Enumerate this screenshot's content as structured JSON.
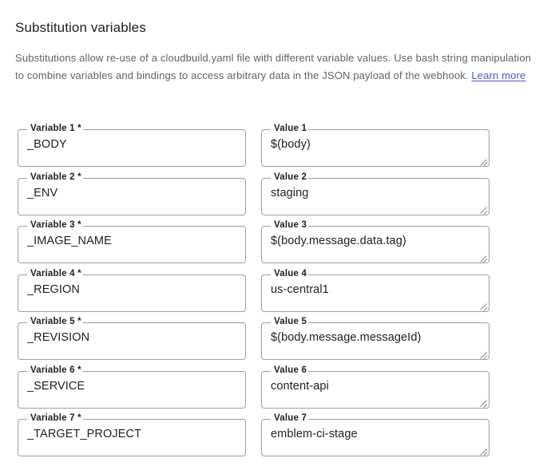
{
  "section": {
    "title": "Substitution variables",
    "description_before_link": "Substitutions allow re-use of a cloudbuild.yaml file with different variable values. Use bash string manipulation to combine variables and bindings to access arbitrary data in the JSON payload of the webhook. ",
    "link_label": "Learn more",
    "link_color": "#4b56d2"
  },
  "colors": {
    "title_text": "#202124",
    "body_text": "#5f6368",
    "field_outline": "#9aa0a6",
    "field_label": "#202124",
    "field_value": "#202124",
    "background": "#ffffff"
  },
  "rows": [
    {
      "variable": {
        "label": "Variable 1 *",
        "value": "_BODY",
        "placeholder": ""
      },
      "value": {
        "label": "Value 1",
        "value": "$(body)",
        "placeholder": ""
      }
    },
    {
      "variable": {
        "label": "Variable 2 *",
        "value": "_ENV",
        "placeholder": ""
      },
      "value": {
        "label": "Value 2",
        "value": "staging",
        "placeholder": ""
      }
    },
    {
      "variable": {
        "label": "Variable 3 *",
        "value": "_IMAGE_NAME",
        "placeholder": ""
      },
      "value": {
        "label": "Value 3",
        "value": "$(body.message.data.tag)",
        "placeholder": ""
      }
    },
    {
      "variable": {
        "label": "Variable 4 *",
        "value": "_REGION",
        "placeholder": ""
      },
      "value": {
        "label": "Value 4",
        "value": "us-central1",
        "placeholder": ""
      }
    },
    {
      "variable": {
        "label": "Variable 5 *",
        "value": "_REVISION",
        "placeholder": ""
      },
      "value": {
        "label": "Value 5",
        "value": "$(body.message.messageId)",
        "placeholder": ""
      }
    },
    {
      "variable": {
        "label": "Variable 6 *",
        "value": "_SERVICE",
        "placeholder": ""
      },
      "value": {
        "label": "Value 6",
        "value": "content-api",
        "placeholder": ""
      }
    },
    {
      "variable": {
        "label": "Variable 7 *",
        "value": "_TARGET_PROJECT",
        "placeholder": ""
      },
      "value": {
        "label": "Value 7",
        "value": "emblem-ci-stage",
        "placeholder": ""
      }
    }
  ]
}
